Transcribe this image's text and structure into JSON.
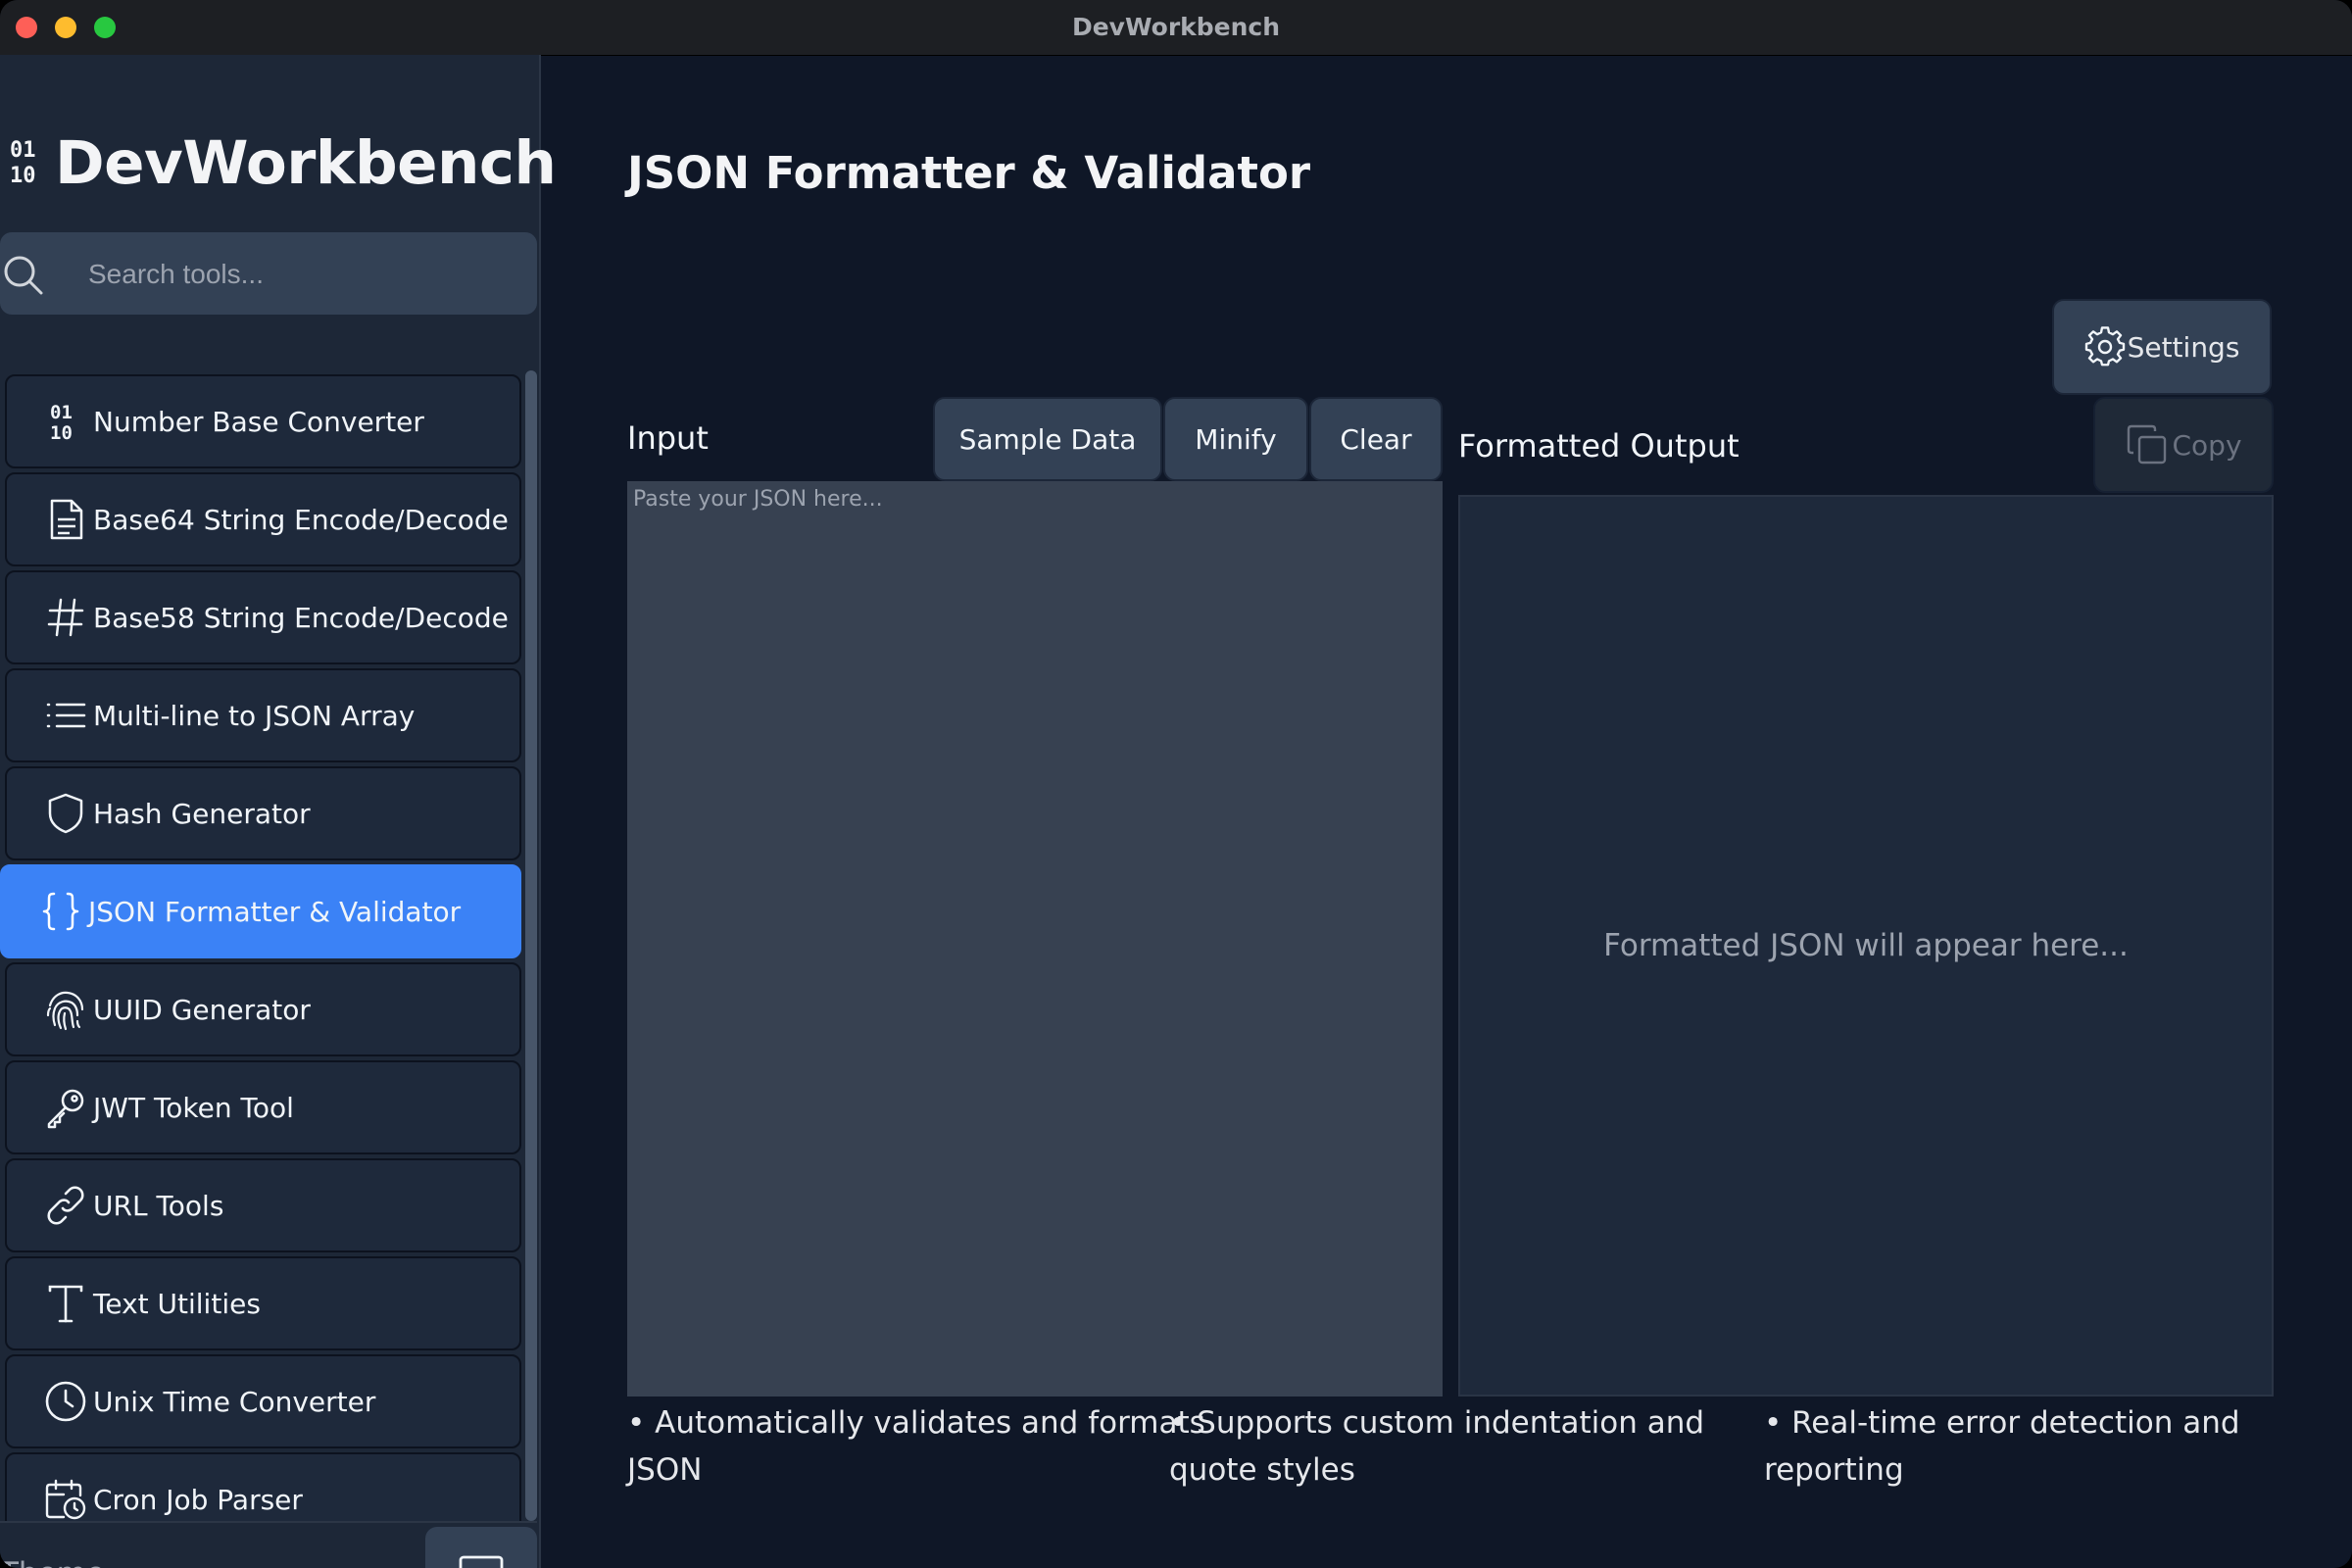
{
  "window": {
    "title": "DevWorkbench"
  },
  "sidebar": {
    "brand_name": "DevWorkbench",
    "brand_icon": "binary-icon",
    "search": {
      "placeholder": "Search tools...",
      "value": ""
    },
    "items": [
      {
        "label": "Number Base Converter",
        "icon": "binary-icon",
        "active": false
      },
      {
        "label": "Base64 String Encode/Decode",
        "icon": "document-icon",
        "active": false
      },
      {
        "label": "Base58 String Encode/Decode",
        "icon": "hash-icon",
        "active": false
      },
      {
        "label": "Multi-line to JSON Array",
        "icon": "list-icon",
        "active": false
      },
      {
        "label": "Hash Generator",
        "icon": "shield-icon",
        "active": false
      },
      {
        "label": "JSON Formatter & Validator",
        "icon": "braces-icon",
        "active": true
      },
      {
        "label": "UUID Generator",
        "icon": "fingerprint-icon",
        "active": false
      },
      {
        "label": "JWT Token Tool",
        "icon": "key-icon",
        "active": false
      },
      {
        "label": "URL Tools",
        "icon": "link-icon",
        "active": false
      },
      {
        "label": "Text Utilities",
        "icon": "text-icon",
        "active": false
      },
      {
        "label": "Unix Time Converter",
        "icon": "clock-icon",
        "active": false
      },
      {
        "label": "Cron Job Parser",
        "icon": "calendar-clock-icon",
        "active": false
      }
    ],
    "theme": {
      "label": "Theme",
      "button_icon": "monitor-icon"
    }
  },
  "main": {
    "title": "JSON Formatter & Validator",
    "settings_label": "Settings",
    "input": {
      "label": "Input",
      "placeholder": "Paste your JSON here...",
      "value": "",
      "buttons": {
        "sample": "Sample Data",
        "minify": "Minify",
        "clear": "Clear"
      }
    },
    "output": {
      "label": "Formatted Output",
      "copy_label": "Copy",
      "placeholder": "Formatted JSON will appear here..."
    },
    "features": [
      "• Automatically validates and formats JSON",
      "• Supports custom indentation and quote styles",
      "• Real-time error detection and reporting"
    ]
  },
  "colors": {
    "accent": "#3b82f6",
    "background": "#0f1727",
    "sidebar": "#1d2737",
    "panel": "#1e293b",
    "input": "#374151"
  }
}
